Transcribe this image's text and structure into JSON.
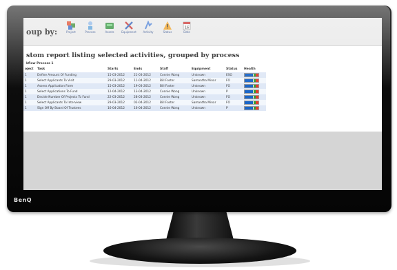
{
  "toolbar": {
    "group_label": "oup by:",
    "right_link": "",
    "tools": [
      {
        "label": "Project",
        "icon": "project-icon"
      },
      {
        "label": "Process",
        "icon": "process-icon"
      },
      {
        "label": "Assets",
        "icon": "assets-icon"
      },
      {
        "label": "Equipment",
        "icon": "equipment-icon"
      },
      {
        "label": "Activity",
        "icon": "activity-icon"
      },
      {
        "label": "Status",
        "icon": "status-warning-icon"
      },
      {
        "label": "Date",
        "icon": "calendar-icon"
      }
    ]
  },
  "report": {
    "title": "stom report listing selected activities, grouped by process",
    "subtitle": "kflow Process 1"
  },
  "table": {
    "headers": [
      "oject",
      "Task",
      "Starts",
      "Ends",
      "Staff",
      "Equipment",
      "Status",
      "Health"
    ],
    "rows": [
      {
        "project": "1",
        "task": "Define Amount Of Funding",
        "starts": "15-03-2012",
        "ends": "21-03-2012",
        "staff": "Connie Wong",
        "equipment": "Unknown",
        "status": "ESO",
        "health": 0.6
      },
      {
        "project": "1",
        "task": "Select Applicants To Visit",
        "starts": "29-03-2012",
        "ends": "11-04-2012",
        "staff": "Bill Foster",
        "equipment": "Samantha Minar",
        "status": "FO",
        "health": 0.6
      },
      {
        "project": "1",
        "task": "Assess Application Form",
        "starts": "15-03-2012",
        "ends": "19-03-2012",
        "staff": "Bill Foster",
        "equipment": "Unknown",
        "status": "FO",
        "health": 0.6
      },
      {
        "project": "1",
        "task": "Select Applications To Fund",
        "starts": "12-04-2012",
        "ends": "13-04-2012",
        "staff": "Connie Wong",
        "equipment": "Unknown",
        "status": "P",
        "health": 0.6
      },
      {
        "project": "1",
        "task": "Decide Number Of Projects To Fund",
        "starts": "22-03-2012",
        "ends": "28-03-2012",
        "staff": "Connie Wong",
        "equipment": "Unknown",
        "status": "FO",
        "health": 0.6
      },
      {
        "project": "1",
        "task": "Select Applicants To Interview",
        "starts": "29-03-2012",
        "ends": "02-04-2012",
        "staff": "Bill Foster",
        "equipment": "Samantha Minar",
        "status": "FO",
        "health": 0.6
      },
      {
        "project": "1",
        "task": "Sign Off By Board Of Trustees",
        "starts": "16-04-2012",
        "ends": "16-04-2012",
        "staff": "Connie Wong",
        "equipment": "Unknown",
        "status": "P",
        "health": 0.6
      }
    ]
  },
  "monitor": {
    "brand": "BenQ",
    "buttons": ""
  },
  "colors": {
    "row_odd": "#dfe8f6",
    "row_even": "#f3f7fc",
    "health_blue": "#1a66c9",
    "health_red": "#e53b2a",
    "health_green": "#35a035"
  }
}
